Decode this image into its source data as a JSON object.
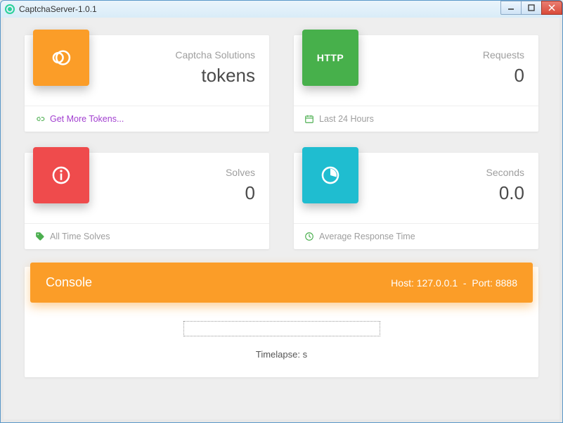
{
  "window": {
    "title": "CaptchaServer-1.0.1"
  },
  "cards": {
    "tokens": {
      "label": "Captcha Solutions",
      "value": "tokens",
      "footer_link": "Get More Tokens...",
      "icon_name": "circle-overlap-icon"
    },
    "requests": {
      "label": "Requests",
      "value": "0",
      "footer_text": "Last 24 Hours",
      "badge_text": "HTTP",
      "icon_name": "http-icon"
    },
    "solves": {
      "label": "Solves",
      "value": "0",
      "footer_text": "All Time Solves",
      "icon_name": "info-icon"
    },
    "seconds": {
      "label": "Seconds",
      "value": "0.0",
      "footer_text": "Average Response Time",
      "icon_name": "clock-icon"
    }
  },
  "console": {
    "title": "Console",
    "host_label": "Host:",
    "host": "127.0.0.1",
    "sep": "-",
    "port_label": "Port:",
    "port": "8888",
    "timelapse_label": "Timelapse:",
    "timelapse_value": "s"
  }
}
